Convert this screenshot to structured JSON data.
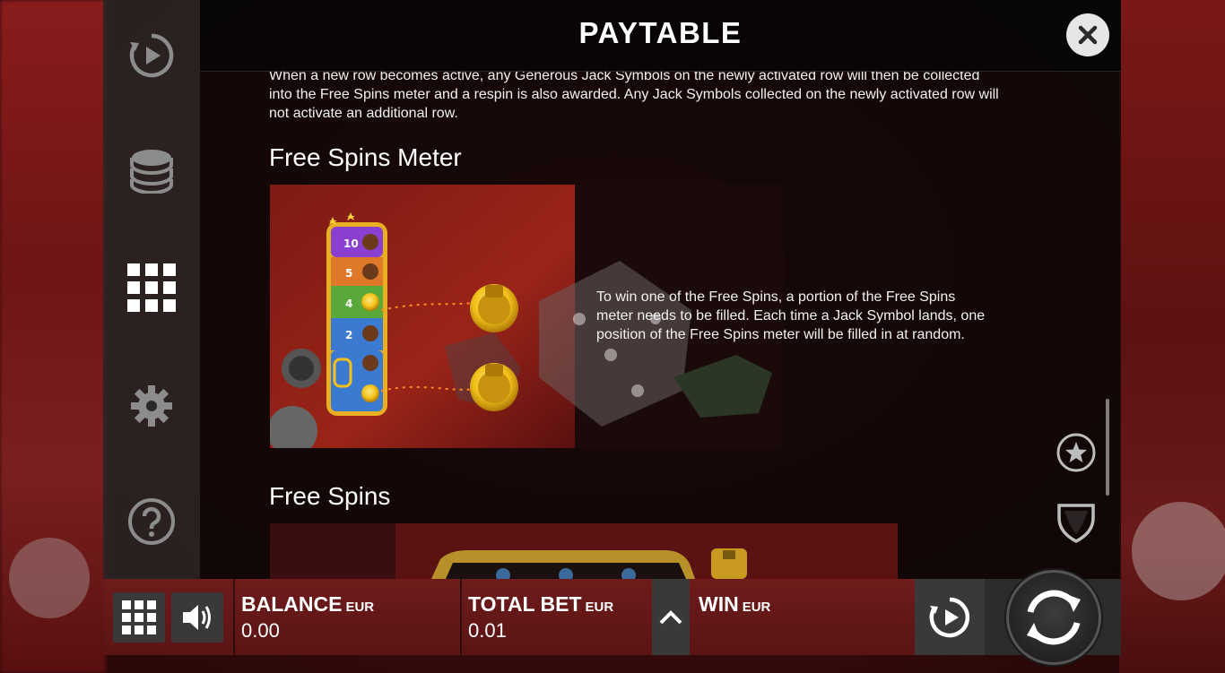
{
  "header": {
    "title": "PAYTABLE"
  },
  "content": {
    "intro_paragraph": "When a new row becomes active, any Generous Jack Symbols on the newly activated row will then be collected into the Free Spins meter and a respin is also awarded. Any Jack Symbols collected on the newly activated row will not activate an additional row.",
    "meter_section": {
      "title": "Free Spins Meter",
      "description": "To win one of the Free Spins, a portion of the Free Spins meter needs to be filled. Each time a Jack Symbol lands, one position of the Free Spins meter will be filled in at random.",
      "meter_values": [
        "10",
        "5",
        "4",
        "2"
      ]
    },
    "free_spins_section": {
      "title": "Free Spins"
    }
  },
  "nav": {
    "items": [
      {
        "icon": "replay-icon"
      },
      {
        "icon": "coins-icon"
      },
      {
        "icon": "paytable-grid-icon",
        "active": true
      },
      {
        "icon": "gear-icon"
      },
      {
        "icon": "help-icon"
      }
    ]
  },
  "right_controls": {
    "fav_icon": "star-icon",
    "shield_icon": "shield-icon"
  },
  "bottom_bar": {
    "balance": {
      "label": "BALANCE",
      "currency": "EUR",
      "value": "0.00"
    },
    "total_bet": {
      "label": "TOTAL BET",
      "currency": "EUR",
      "value": "0.01"
    },
    "win": {
      "label": "WIN",
      "currency": "EUR",
      "value": ""
    }
  },
  "colors": {
    "panel_bg": "#0a0606",
    "bottom_bar": "#6e1b1b",
    "button_bg": "#3a3838",
    "meter_purple": "#8a3fd0",
    "meter_orange": "#e0782a",
    "meter_green": "#5aa83a",
    "meter_blue": "#3a7ad0",
    "coin_gold": "#f2c21a"
  }
}
